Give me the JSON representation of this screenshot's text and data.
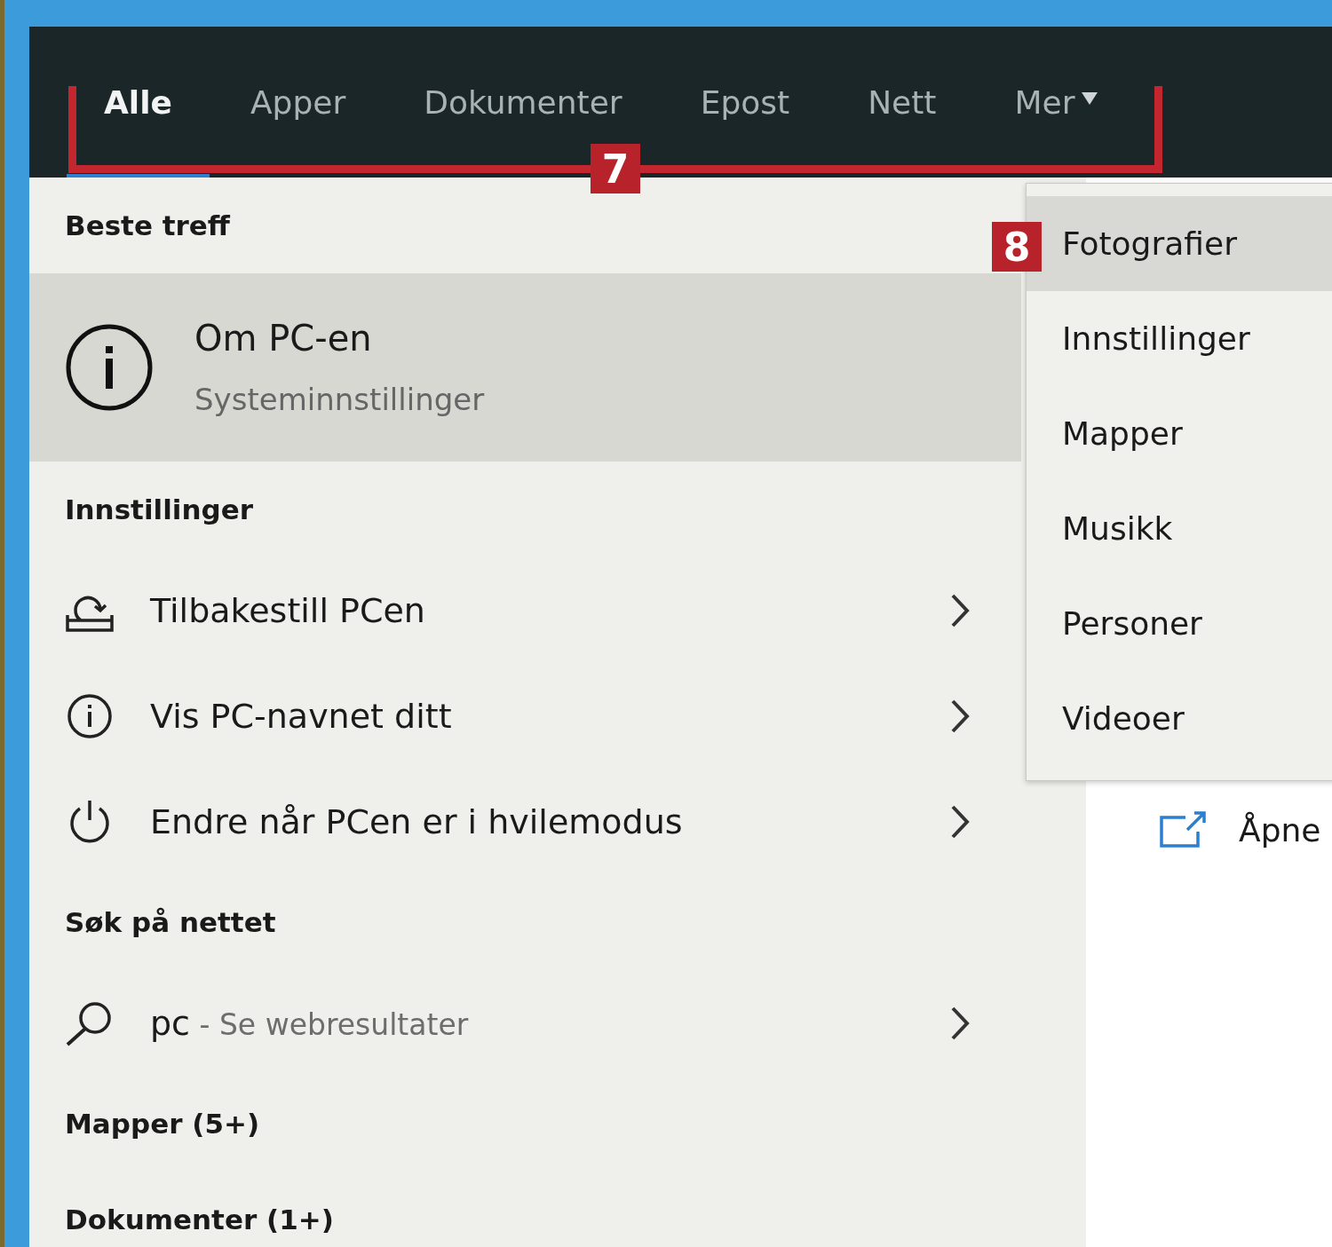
{
  "tabs": [
    {
      "label": "Alle",
      "selected": true,
      "kind": "tab"
    },
    {
      "label": "Apper",
      "selected": false,
      "kind": "tab"
    },
    {
      "label": "Dokumenter",
      "selected": false,
      "kind": "tab"
    },
    {
      "label": "Epost",
      "selected": false,
      "kind": "tab"
    },
    {
      "label": "Nett",
      "selected": false,
      "kind": "tab"
    },
    {
      "label": "Mer",
      "selected": false,
      "kind": "dropdown"
    }
  ],
  "callouts": [
    {
      "label": "7",
      "kind": "bracket"
    },
    {
      "label": "8",
      "kind": "badge"
    }
  ],
  "best_match": {
    "heading": "Beste treff",
    "title": "Om PC-en",
    "subtitle": "Systeminnstillinger",
    "selected": true
  },
  "sections": [
    {
      "heading": "Innstillinger",
      "items": [
        {
          "kind": "reset",
          "label": "Tilbakestill PCen"
        },
        {
          "kind": "info",
          "label": "Vis PC-navnet ditt"
        },
        {
          "kind": "power",
          "label": "Endre når PCen er i hvilemodus"
        }
      ]
    },
    {
      "heading": "Søk på nettet",
      "items": [
        {
          "kind": "search",
          "label": "pc",
          "hint": " - Se webresultater"
        }
      ]
    },
    {
      "heading": "Mapper (5+)"
    },
    {
      "heading": "Dokumenter (1+)"
    }
  ],
  "menu": {
    "items": [
      {
        "label": "Fotografier",
        "selected": true
      },
      {
        "label": "Innstillinger",
        "selected": false
      },
      {
        "label": "Mapper",
        "selected": false
      },
      {
        "label": "Musikk",
        "selected": false
      },
      {
        "label": "Personer",
        "selected": false
      },
      {
        "label": "Videoer",
        "selected": false
      }
    ]
  },
  "preview": {
    "action": "Åpne"
  }
}
